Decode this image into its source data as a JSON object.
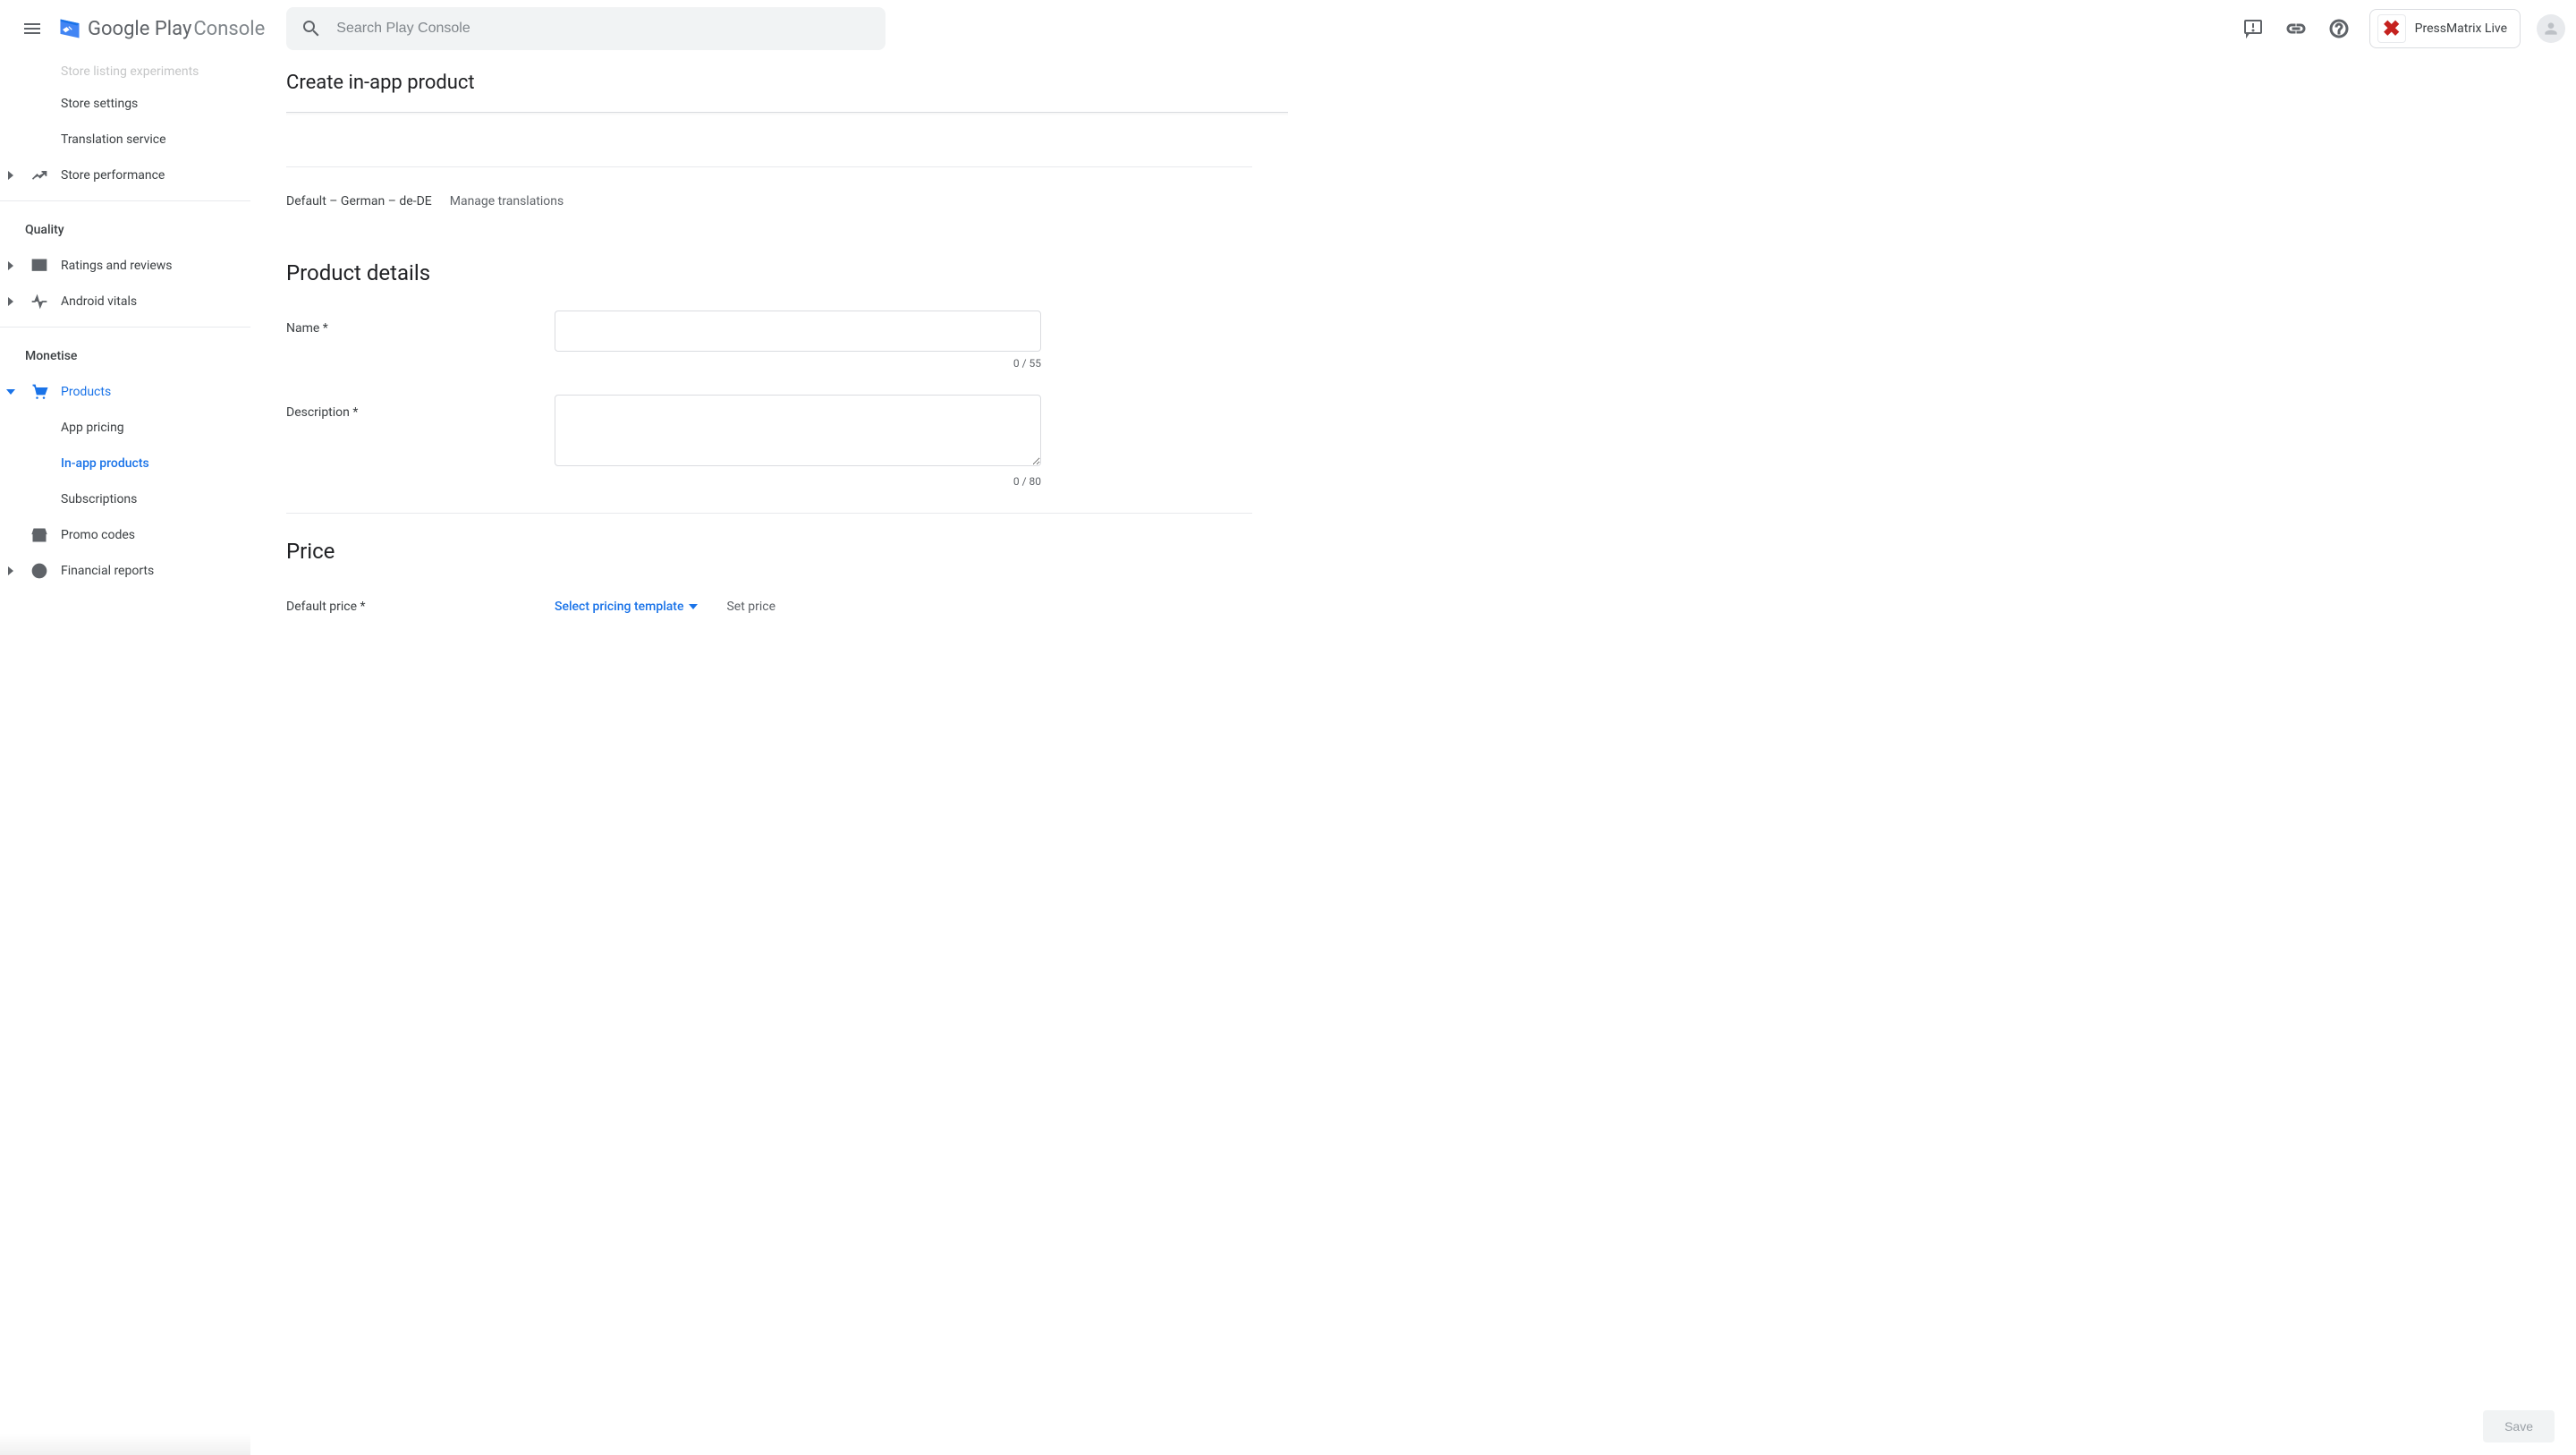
{
  "header": {
    "logo_text_1": "Google Play",
    "logo_text_2": "Console",
    "search_placeholder": "Search Play Console",
    "app_name": "PressMatrix Live"
  },
  "sidebar": {
    "truncated_top": "Store listing experiments",
    "items": [
      {
        "label": "Store settings"
      },
      {
        "label": "Translation service"
      },
      {
        "label": "Store performance"
      }
    ],
    "quality_header": "Quality",
    "quality_items": [
      {
        "label": "Ratings and reviews"
      },
      {
        "label": "Android vitals"
      }
    ],
    "monetise_header": "Monetise",
    "products_label": "Products",
    "products_subs": [
      {
        "label": "App pricing"
      },
      {
        "label": "In-app products"
      },
      {
        "label": "Subscriptions"
      }
    ],
    "promo_label": "Promo codes",
    "financial_label": "Financial reports"
  },
  "main": {
    "page_title": "Create in-app product",
    "default_lang": "Default – German – de-DE",
    "manage_translations": "Manage translations",
    "section_product_details": "Product details",
    "label_name": "Name  *",
    "counter_name": "0 / 55",
    "label_description": "Description  *",
    "counter_description": "0 / 80",
    "section_price": "Price",
    "label_default_price": "Default price  *",
    "pricing_template": "Select pricing template",
    "set_price": "Set price"
  },
  "footer": {
    "save": "Save"
  }
}
